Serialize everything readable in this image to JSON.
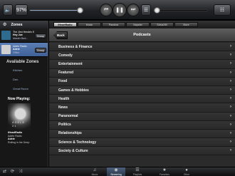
{
  "topbar": {
    "volume_label": "97%",
    "volume_level": 0.97,
    "position_level": 0.0
  },
  "zones": {
    "header": "Zones",
    "items": [
      {
        "line1": "The Jimi Hendrix Expe...",
        "line2": "Hey Joe",
        "line3": "Master Bed...",
        "group_label": "Group",
        "art_color": "#2d6b8f"
      },
      {
        "line1": "Adele Radio",
        "line2": "Adele",
        "line3": "Office",
        "group_label": "Group",
        "art_color": "#d0d0d0"
      }
    ]
  },
  "available_zones": {
    "header": "Available Zones",
    "items": [
      "Kitchen",
      "Den",
      "Great Room"
    ]
  },
  "now_playing": {
    "header": "Now Playing:",
    "art_text": "ADELE 21",
    "source": "iHeartRadio",
    "station": "Adele Radio",
    "artist": "Adele",
    "track": "Rolling in the Deep"
  },
  "tabs": [
    {
      "label": "iHeartRadio",
      "active": true
    },
    {
      "label": "Music",
      "active": false
    },
    {
      "label": "Pandora",
      "active": false
    },
    {
      "label": "Napster",
      "active": false
    },
    {
      "label": "SiriusXM",
      "active": false
    },
    {
      "label": "More",
      "active": false
    }
  ],
  "nav": {
    "back_label": "Back",
    "title": "Podcasts"
  },
  "categories": [
    "Business & Finance",
    "Comedy",
    "Entertainment",
    "Featured",
    "Food",
    "Games & Hobbies",
    "Health",
    "News",
    "Paranormal",
    "Politics",
    "Relationships",
    "Science & Technology",
    "Society & Culture"
  ],
  "bottombar": {
    "items": [
      {
        "label": "Music",
        "icon": "music-note-icon",
        "active": false
      },
      {
        "label": "Streaming",
        "icon": "streaming-icon",
        "active": true
      },
      {
        "label": "Playlists",
        "icon": "playlist-icon",
        "active": false
      },
      {
        "label": "Favorites",
        "icon": "star-icon",
        "active": false
      },
      {
        "label": "Other",
        "icon": "more-icon",
        "active": false
      }
    ]
  }
}
